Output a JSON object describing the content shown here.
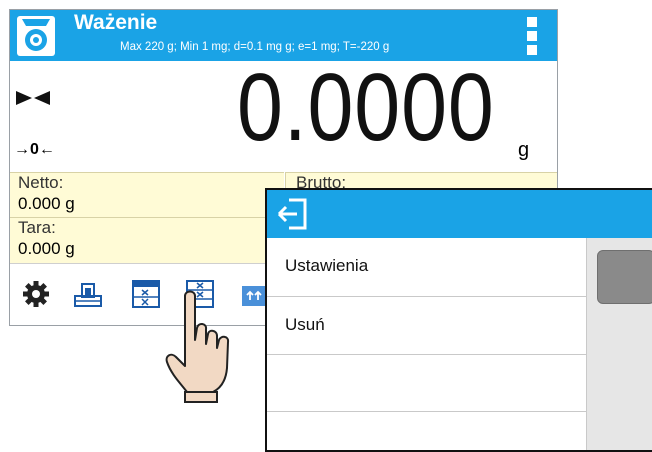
{
  "header": {
    "title": "Ważenie",
    "subtitle": "Max 220 g; Min 1 mg; d=0.1 mg g; e=1 mg; T=-220 g"
  },
  "display": {
    "reading": "0.0000",
    "unit": "g",
    "zero_indicator": "→0←"
  },
  "info": {
    "netto_label": "Netto:",
    "netto_value": "0.000 g",
    "tara_label": "Tara:",
    "tara_value": "0.000 g",
    "brutto_label": "Brutto:"
  },
  "toolbar": {
    "icons": [
      "gear-icon",
      "tare-weight-icon",
      "grid-multiply-icon",
      "grid-multiply-icon-active",
      "arrows-up-icon"
    ]
  },
  "popup": {
    "items": [
      "Ustawienia",
      "Usuń",
      ""
    ]
  },
  "colors": {
    "accent": "#1aa3e6",
    "info_bg": "#fffbd6",
    "scroll_thumb": "#8a8a8a"
  }
}
